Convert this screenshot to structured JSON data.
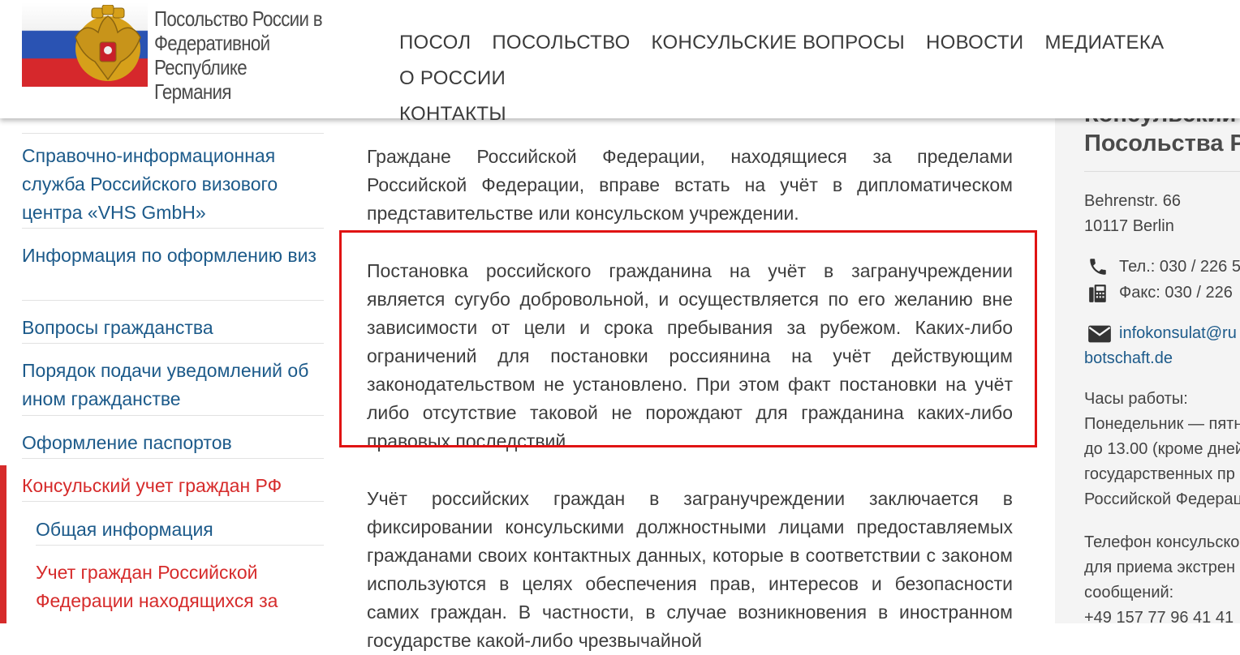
{
  "header": {
    "logo_line1": "Посольство России в",
    "logo_line2": "Федеративной Республике",
    "logo_line3": "Германия",
    "nav": [
      "ПОСОЛ",
      "ПОСОЛЬСТВО",
      "КОНСУЛЬСКИЕ ВОПРОСЫ",
      "НОВОСТИ",
      "МЕДИАТЕКА",
      "О РОССИИ",
      "КОНТАКТЫ"
    ]
  },
  "sidebar": {
    "items": [
      "Справочно-информационная служба Российского визового центра «VHS GmbH»",
      "Информация по оформлению виз",
      "Вопросы гражданства",
      "Порядок подачи уведомлений об ином гражданстве",
      "Оформление паспортов",
      "Консульский учет граждан РФ",
      "Общая информация",
      "Учет граждан Российской Федерации находящихся за"
    ]
  },
  "main": {
    "para1": "Граждане Российской Федерации, находящиеся за пределами Российской Федерации, вправе встать на учёт в дипломатическом представительстве или консульском учреждении.",
    "para2": "Постановка российского гражданина на учёт в загранучреждении является сугубо добровольной, и осуществляется по его желанию вне зависимости от цели и срока пребывания за рубежом. Каких-либо ограничений для постановки россиянина на учёт действующим законодательством не установлено. При этом факт постановки на учёт либо отсутствие таковой не порождают для гражданина каких-либо правовых последствий.",
    "para3": "Учёт российских граждан в загранучреждении заключается в фиксировании консульскими должностными лицами предоставляемых гражданами своих контактных данных, которые в соответствии с законом используются в целях обеспечения прав, интересов и безопасности самих граждан. В частности, в случае возникновения в иностранном государстве какой-либо чрезвычайной"
  },
  "right": {
    "title1": "Консульский о",
    "title2": "Посольства РФ",
    "address1": "Behrenstr. 66",
    "address2": "10117 Berlin",
    "phone": "Тел.: 030 / 226 5",
    "fax": "Факс: 030 / 226",
    "email1": "infokonsulat@ru",
    "email2": "botschaft.de",
    "hours_label": "Часы работы:",
    "hours1": "Понедельник — пятн",
    "hours2": "до 13.00 (кроме дней",
    "hours3": "государственных пр",
    "hours4": "Российской Федерац",
    "emergency1": "Телефон консульско",
    "emergency2": "для приема экстрен",
    "emergency3": "сообщений:",
    "emergency4": "+49 157 77 96 41 41"
  },
  "colors": {
    "link": "#1c5a8a",
    "active": "#d62b2b",
    "highlight_border": "#e01313"
  }
}
